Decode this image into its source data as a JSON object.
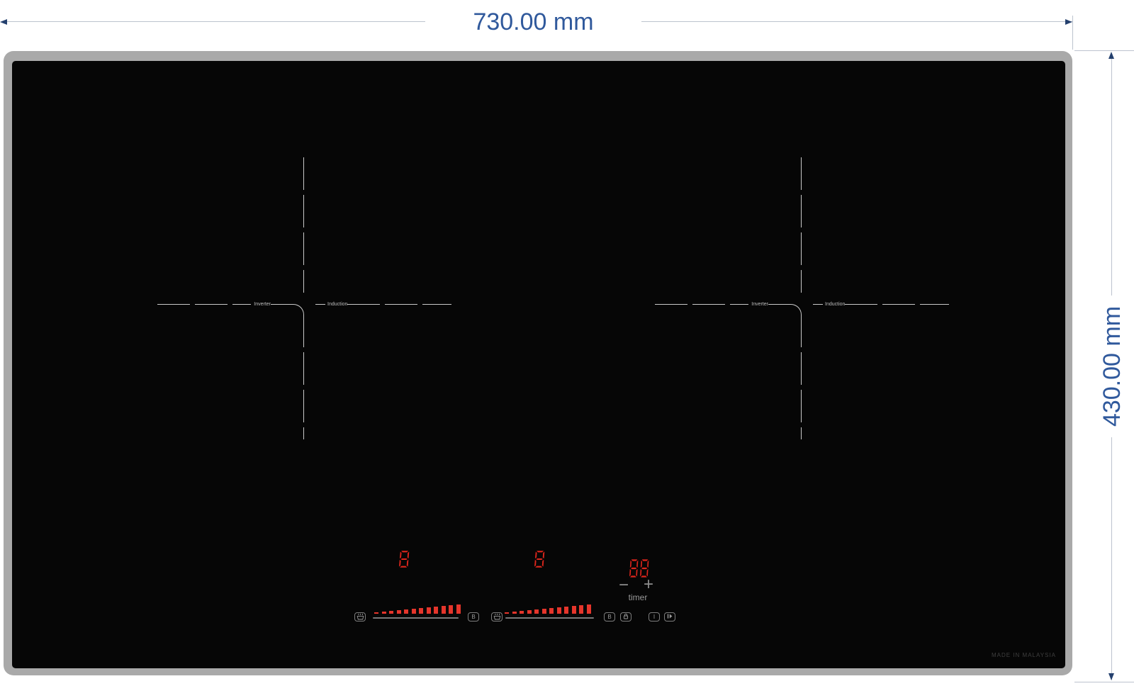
{
  "dimension_annotations": {
    "width_label": "730.00 mm",
    "height_label": "430.00 mm",
    "accent_color": "#30599c"
  },
  "cooktop": {
    "frame_color": "#a9a9a9",
    "glass_color": "#060606",
    "led_color": "#e0261c",
    "bar_color": "#e5352b",
    "zones": [
      {
        "left_label": "Inverter",
        "right_label": "Induction"
      },
      {
        "left_label": "Inverter",
        "right_label": "Induction"
      }
    ],
    "controls": {
      "left_zone": {
        "display": "8",
        "bar_count": 12,
        "boost_label": "B"
      },
      "right_zone": {
        "display": "8",
        "bar_count": 12,
        "boost_label": "B"
      },
      "timer": {
        "display": "88",
        "minus_label": "−",
        "plus_label": "+",
        "label": "timer"
      },
      "power_label": "I"
    },
    "made_in": "MADE IN MALAYSIA"
  }
}
